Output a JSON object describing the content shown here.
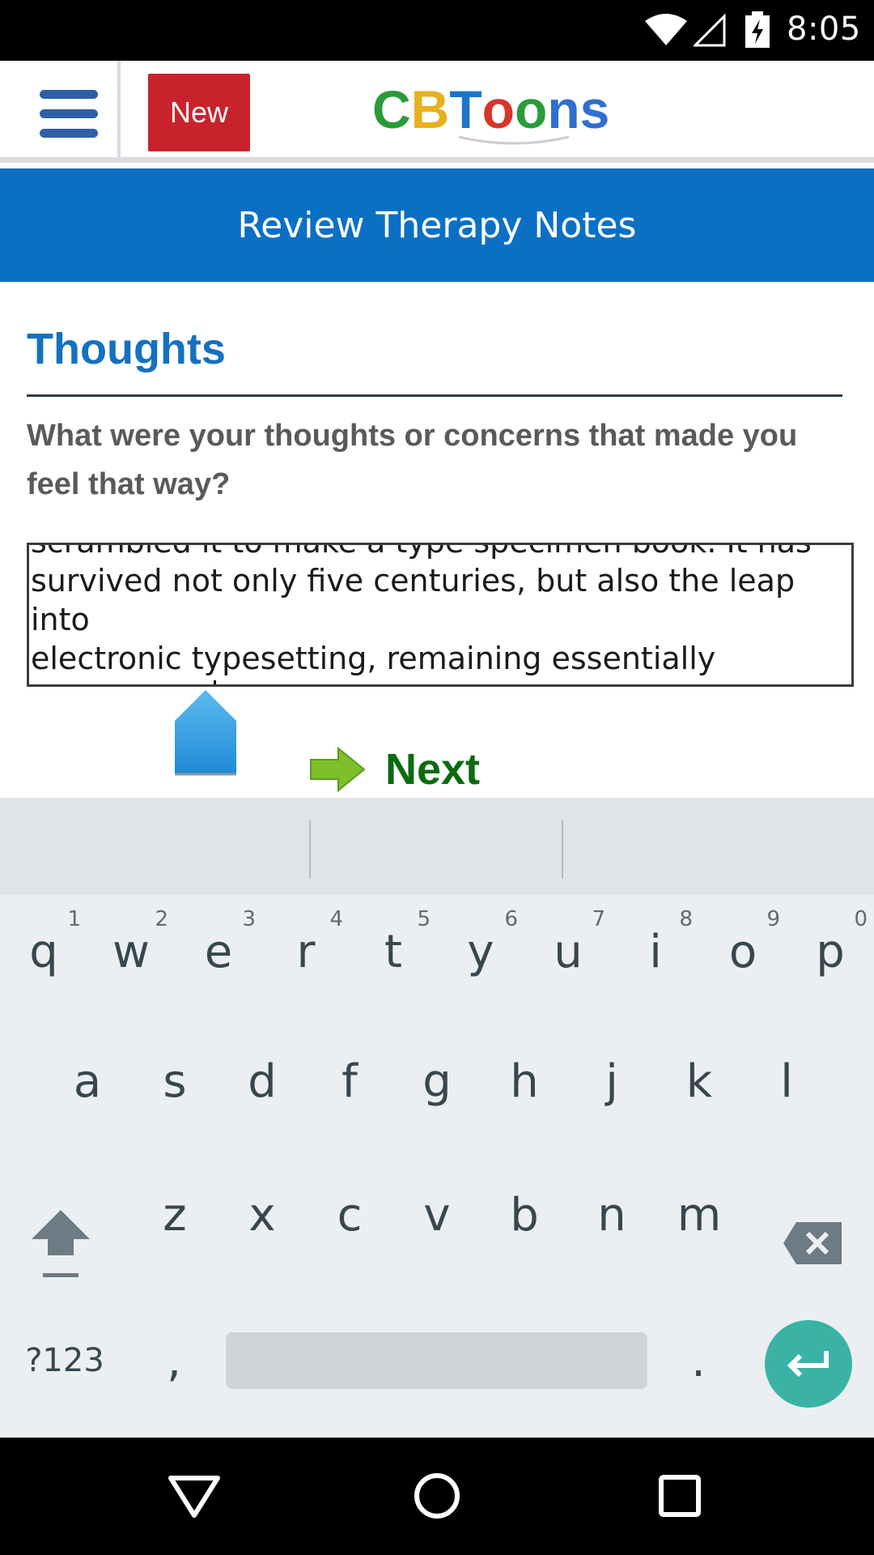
{
  "status_bar": {
    "time": "8:05",
    "icons": [
      "wifi-icon",
      "signal-icon",
      "battery-charging-icon"
    ]
  },
  "header": {
    "menu_icon": "hamburger-menu-icon",
    "new_label": "New",
    "logo_letters": [
      {
        "char": "C",
        "color": "#2a9a3a"
      },
      {
        "char": "B",
        "color": "#e6b11f"
      },
      {
        "char": "T",
        "color": "#1c76c8"
      },
      {
        "char": "o",
        "color": "#d7352b"
      },
      {
        "char": "o",
        "color": "#2a9a3a"
      },
      {
        "char": "n",
        "color": "#2f6fd0"
      },
      {
        "char": "s",
        "color": "#2f6fd0"
      }
    ]
  },
  "page": {
    "title": "Review Therapy Notes",
    "section_heading": "Thoughts",
    "question": "What were your thoughts or concerns that made you feel that way?",
    "answer_text": "scrambled it to make a type specimen book. It has\nsurvived not only five centuries, but also the leap into\nelectronic typesetting, remaining essentially\nunchanged.",
    "next_label": "Next"
  },
  "keyboard": {
    "row1": [
      {
        "key": "q",
        "hint": "1"
      },
      {
        "key": "w",
        "hint": "2"
      },
      {
        "key": "e",
        "hint": "3"
      },
      {
        "key": "r",
        "hint": "4"
      },
      {
        "key": "t",
        "hint": "5"
      },
      {
        "key": "y",
        "hint": "6"
      },
      {
        "key": "u",
        "hint": "7"
      },
      {
        "key": "i",
        "hint": "8"
      },
      {
        "key": "o",
        "hint": "9"
      },
      {
        "key": "p",
        "hint": "0"
      }
    ],
    "row2": [
      "a",
      "s",
      "d",
      "f",
      "g",
      "h",
      "j",
      "k",
      "l"
    ],
    "row3": [
      "z",
      "x",
      "c",
      "v",
      "b",
      "n",
      "m"
    ],
    "symbols_label": "?123",
    "comma": ",",
    "period": ".",
    "shift_icon": "shift-icon",
    "backspace_icon": "backspace-icon",
    "enter_icon": "enter-icon"
  },
  "nav_bar": {
    "buttons": [
      "back-icon",
      "home-icon",
      "recents-icon"
    ]
  },
  "colors": {
    "title_band": "#0b70c4",
    "heading": "#1571bf",
    "new_button": "#c8232c",
    "next_text": "#0b6b10",
    "enter_key": "#3ab3a6"
  }
}
